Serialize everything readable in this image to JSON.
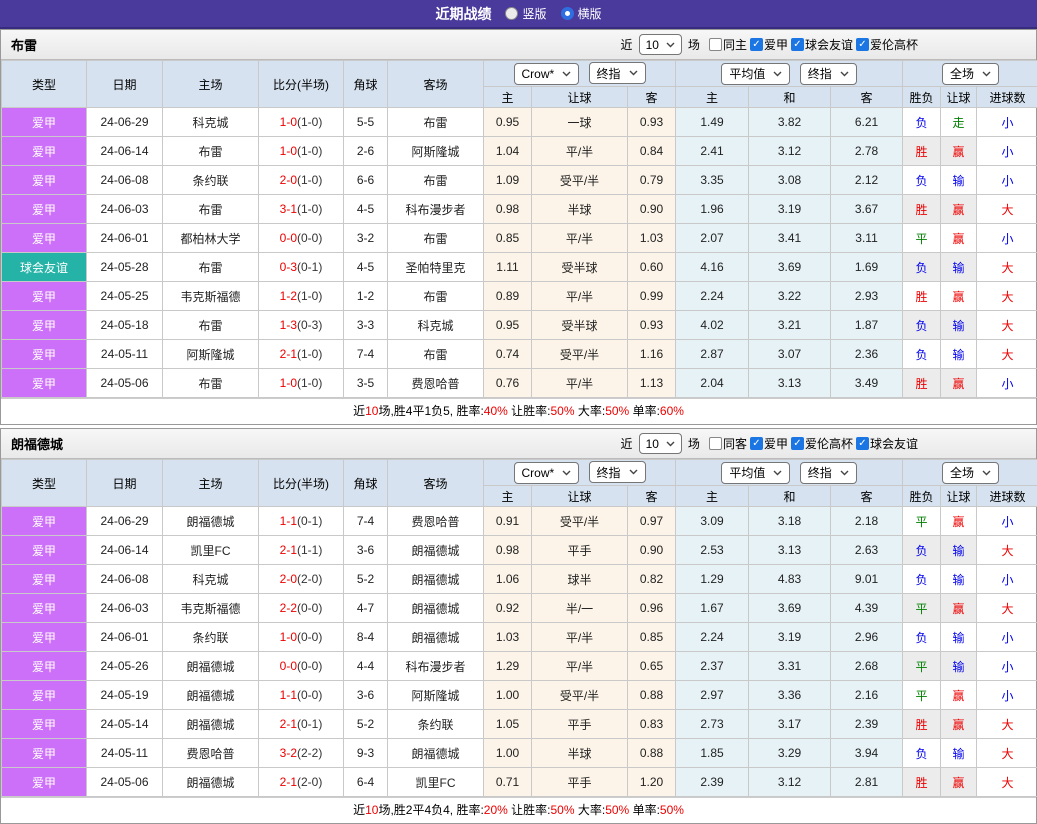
{
  "top_bar": {
    "title": "近期战绩",
    "options": [
      {
        "label": "竖版",
        "selected": false
      },
      {
        "label": "横版",
        "selected": true
      }
    ]
  },
  "table_header": {
    "type": "类型",
    "date": "日期",
    "home": "主场",
    "score": "比分(半场)",
    "corner": "角球",
    "away": "客场",
    "odds_source": "Crow*",
    "odds_kind": "终指",
    "odds_cols": [
      "主",
      "让球",
      "客"
    ],
    "avg_source": "平均值",
    "avg_kind": "终指",
    "avg_cols": [
      "主",
      "和",
      "客"
    ],
    "full_dropdown": "全场",
    "result_cols": [
      "胜负",
      "让球",
      "进球数"
    ]
  },
  "result_colors": {
    "胜": "red",
    "平": "green",
    "负": "blue",
    "赢": "red",
    "走": "green",
    "输": "blue",
    "大": "red",
    "小": "blue"
  },
  "type_colors": {
    "爱甲": "#cc70f9",
    "球会友谊": "#26b3a7"
  },
  "accent_colors": {
    "red": "#ee0000",
    "green": "#008000",
    "blue": "#0000ee"
  },
  "sections": [
    {
      "team": "布雷",
      "filter": {
        "near": "近",
        "count": "10",
        "unit": "场",
        "same": "同主",
        "same_checked": false,
        "leagues": [
          "爱甲",
          "球会友谊",
          "爱伦高杯"
        ]
      },
      "rows": [
        {
          "lg": "爱甲",
          "dt": "24-06-29",
          "hm": "科克城",
          "ft": "1-0",
          "ht": "(1-0)",
          "cn": "5-5",
          "aw": "布雷",
          "h": "0.95",
          "hc": "一球",
          "a": "0.93",
          "m1": "1.49",
          "m2": "3.82",
          "m3": "6.21",
          "r1": "负",
          "r2": "走",
          "r3": "小"
        },
        {
          "lg": "爱甲",
          "dt": "24-06-14",
          "hm": "布雷",
          "ft": "1-0",
          "ht": "(1-0)",
          "cn": "2-6",
          "aw": "阿斯隆城",
          "h": "1.04",
          "hc": "平/半",
          "a": "0.84",
          "m1": "2.41",
          "m2": "3.12",
          "m3": "2.78",
          "r1": "胜",
          "r2": "赢",
          "r3": "小"
        },
        {
          "lg": "爱甲",
          "dt": "24-06-08",
          "hm": "条约联",
          "ft": "2-0",
          "ht": "(1-0)",
          "cn": "6-6",
          "aw": "布雷",
          "h": "1.09",
          "hc": "受平/半",
          "a": "0.79",
          "m1": "3.35",
          "m2": "3.08",
          "m3": "2.12",
          "r1": "负",
          "r2": "输",
          "r3": "小"
        },
        {
          "lg": "爱甲",
          "dt": "24-06-03",
          "hm": "布雷",
          "ft": "3-1",
          "ht": "(1-0)",
          "cn": "4-5",
          "aw": "科布漫步者",
          "h": "0.98",
          "hc": "半球",
          "a": "0.90",
          "m1": "1.96",
          "m2": "3.19",
          "m3": "3.67",
          "r1": "胜",
          "r2": "赢",
          "r3": "大"
        },
        {
          "lg": "爱甲",
          "dt": "24-06-01",
          "hm": "都柏林大学",
          "ft": "0-0",
          "ht": "(0-0)",
          "cn": "3-2",
          "aw": "布雷",
          "h": "0.85",
          "hc": "平/半",
          "a": "1.03",
          "m1": "2.07",
          "m2": "3.41",
          "m3": "3.11",
          "r1": "平",
          "r2": "赢",
          "r3": "小"
        },
        {
          "lg": "球会友谊",
          "dt": "24-05-28",
          "hm": "布雷",
          "ft": "0-3",
          "ht": "(0-1)",
          "cn": "4-5",
          "aw": "圣帕特里克",
          "h": "1.11",
          "hc": "受半球",
          "a": "0.60",
          "m1": "4.16",
          "m2": "3.69",
          "m3": "1.69",
          "r1": "负",
          "r2": "输",
          "r3": "大"
        },
        {
          "lg": "爱甲",
          "dt": "24-05-25",
          "hm": "韦克斯福德",
          "ft": "1-2",
          "ht": "(1-0)",
          "cn": "1-2",
          "aw": "布雷",
          "h": "0.89",
          "hc": "平/半",
          "a": "0.99",
          "m1": "2.24",
          "m2": "3.22",
          "m3": "2.93",
          "r1": "胜",
          "r2": "赢",
          "r3": "大"
        },
        {
          "lg": "爱甲",
          "dt": "24-05-18",
          "hm": "布雷",
          "ft": "1-3",
          "ht": "(0-3)",
          "cn": "3-3",
          "aw": "科克城",
          "h": "0.95",
          "hc": "受半球",
          "a": "0.93",
          "m1": "4.02",
          "m2": "3.21",
          "m3": "1.87",
          "r1": "负",
          "r2": "输",
          "r3": "大"
        },
        {
          "lg": "爱甲",
          "dt": "24-05-11",
          "hm": "阿斯隆城",
          "ft": "2-1",
          "ht": "(1-0)",
          "cn": "7-4",
          "aw": "布雷",
          "h": "0.74",
          "hc": "受平/半",
          "a": "1.16",
          "m1": "2.87",
          "m2": "3.07",
          "m3": "2.36",
          "r1": "负",
          "r2": "输",
          "r3": "大"
        },
        {
          "lg": "爱甲",
          "dt": "24-05-06",
          "hm": "布雷",
          "ft": "1-0",
          "ht": "(1-0)",
          "cn": "3-5",
          "aw": "费恩哈普",
          "h": "0.76",
          "hc": "平/半",
          "a": "1.13",
          "m1": "2.04",
          "m2": "3.13",
          "m3": "3.49",
          "r1": "胜",
          "r2": "赢",
          "r3": "小"
        }
      ],
      "summary": [
        {
          "t": "近"
        },
        {
          "t": "10",
          "r": 1
        },
        {
          "t": "场,胜4平1负5, 胜率:"
        },
        {
          "t": "40%",
          "r": 1
        },
        {
          "t": " 让胜率:"
        },
        {
          "t": "50%",
          "r": 1
        },
        {
          "t": " 大率:"
        },
        {
          "t": "50%",
          "r": 1
        },
        {
          "t": " 单率:"
        },
        {
          "t": "60%",
          "r": 1
        }
      ]
    },
    {
      "team": "朗福德城",
      "filter": {
        "near": "近",
        "count": "10",
        "unit": "场",
        "same": "同客",
        "same_checked": false,
        "leagues": [
          "爱甲",
          "爱伦高杯",
          "球会友谊"
        ]
      },
      "rows": [
        {
          "lg": "爱甲",
          "dt": "24-06-29",
          "hm": "朗福德城",
          "ft": "1-1",
          "ht": "(0-1)",
          "cn": "7-4",
          "aw": "费恩哈普",
          "h": "0.91",
          "hc": "受平/半",
          "a": "0.97",
          "m1": "3.09",
          "m2": "3.18",
          "m3": "2.18",
          "r1": "平",
          "r2": "赢",
          "r3": "小"
        },
        {
          "lg": "爱甲",
          "dt": "24-06-14",
          "hm": "凯里FC",
          "ft": "2-1",
          "ht": "(1-1)",
          "cn": "3-6",
          "aw": "朗福德城",
          "h": "0.98",
          "hc": "平手",
          "a": "0.90",
          "m1": "2.53",
          "m2": "3.13",
          "m3": "2.63",
          "r1": "负",
          "r2": "输",
          "r3": "大"
        },
        {
          "lg": "爱甲",
          "dt": "24-06-08",
          "hm": "科克城",
          "ft": "2-0",
          "ht": "(2-0)",
          "cn": "5-2",
          "aw": "朗福德城",
          "h": "1.06",
          "hc": "球半",
          "a": "0.82",
          "m1": "1.29",
          "m2": "4.83",
          "m3": "9.01",
          "r1": "负",
          "r2": "输",
          "r3": "小"
        },
        {
          "lg": "爱甲",
          "dt": "24-06-03",
          "hm": "韦克斯福德",
          "ft": "2-2",
          "ht": "(0-0)",
          "cn": "4-7",
          "aw": "朗福德城",
          "h": "0.92",
          "hc": "半/一",
          "a": "0.96",
          "m1": "1.67",
          "m2": "3.69",
          "m3": "4.39",
          "r1": "平",
          "r2": "赢",
          "r3": "大"
        },
        {
          "lg": "爱甲",
          "dt": "24-06-01",
          "hm": "条约联",
          "ft": "1-0",
          "ht": "(0-0)",
          "cn": "8-4",
          "aw": "朗福德城",
          "h": "1.03",
          "hc": "平/半",
          "a": "0.85",
          "m1": "2.24",
          "m2": "3.19",
          "m3": "2.96",
          "r1": "负",
          "r2": "输",
          "r3": "小"
        },
        {
          "lg": "爱甲",
          "dt": "24-05-26",
          "hm": "朗福德城",
          "ft": "0-0",
          "ht": "(0-0)",
          "cn": "4-4",
          "aw": "科布漫步者",
          "h": "1.29",
          "hc": "平/半",
          "a": "0.65",
          "m1": "2.37",
          "m2": "3.31",
          "m3": "2.68",
          "r1": "平",
          "r2": "输",
          "r3": "小"
        },
        {
          "lg": "爱甲",
          "dt": "24-05-19",
          "hm": "朗福德城",
          "ft": "1-1",
          "ht": "(0-0)",
          "cn": "3-6",
          "aw": "阿斯隆城",
          "h": "1.00",
          "hc": "受平/半",
          "a": "0.88",
          "m1": "2.97",
          "m2": "3.36",
          "m3": "2.16",
          "r1": "平",
          "r2": "赢",
          "r3": "小"
        },
        {
          "lg": "爱甲",
          "dt": "24-05-14",
          "hm": "朗福德城",
          "ft": "2-1",
          "ht": "(0-1)",
          "cn": "5-2",
          "aw": "条约联",
          "h": "1.05",
          "hc": "平手",
          "a": "0.83",
          "m1": "2.73",
          "m2": "3.17",
          "m3": "2.39",
          "r1": "胜",
          "r2": "赢",
          "r3": "大"
        },
        {
          "lg": "爱甲",
          "dt": "24-05-11",
          "hm": "费恩哈普",
          "ft": "3-2",
          "ht": "(2-2)",
          "cn": "9-3",
          "aw": "朗福德城",
          "h": "1.00",
          "hc": "半球",
          "a": "0.88",
          "m1": "1.85",
          "m2": "3.29",
          "m3": "3.94",
          "r1": "负",
          "r2": "输",
          "r3": "大"
        },
        {
          "lg": "爱甲",
          "dt": "24-05-06",
          "hm": "朗福德城",
          "ft": "2-1",
          "ht": "(2-0)",
          "cn": "6-4",
          "aw": "凯里FC",
          "h": "0.71",
          "hc": "平手",
          "a": "1.20",
          "m1": "2.39",
          "m2": "3.12",
          "m3": "2.81",
          "r1": "胜",
          "r2": "赢",
          "r3": "大"
        }
      ],
      "summary": [
        {
          "t": "近"
        },
        {
          "t": "10",
          "r": 1
        },
        {
          "t": "场,胜2平4负4, 胜率:"
        },
        {
          "t": "20%",
          "r": 1
        },
        {
          "t": " 让胜率:"
        },
        {
          "t": "50%",
          "r": 1
        },
        {
          "t": " 大率:"
        },
        {
          "t": "50%",
          "r": 1
        },
        {
          "t": " 单率:"
        },
        {
          "t": "50%",
          "r": 1
        }
      ]
    }
  ]
}
